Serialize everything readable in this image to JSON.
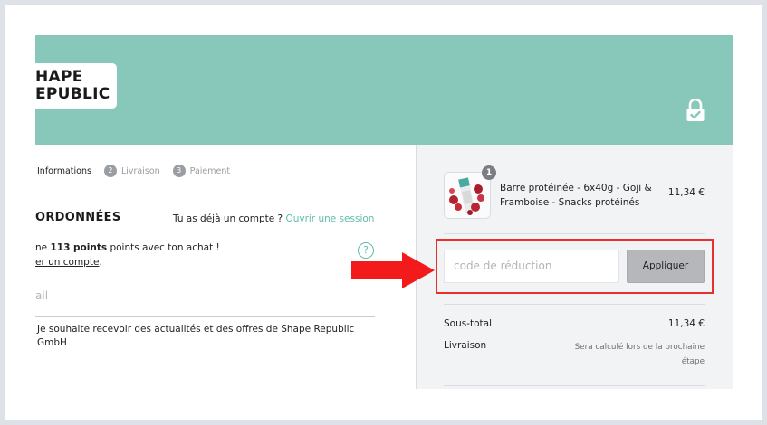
{
  "colors": {
    "header_bg": "#88c8bb",
    "accent": "#5fbcac",
    "highlight_border": "#e8302c",
    "arrow": "#f21a1a"
  },
  "brand": {
    "logo_line1": "HAPE",
    "logo_line2": "EPUBLIC"
  },
  "header": {
    "lock_icon": "lock-check-icon"
  },
  "steps": [
    {
      "label": "Informations"
    },
    {
      "number": "2",
      "label": "Livraison"
    },
    {
      "number": "3",
      "label": "Paiement"
    }
  ],
  "contact": {
    "title": "ORDONNÉES",
    "login_prompt": "Tu as déjà un compte ?",
    "login_link": "Ouvrir une session",
    "points_prefix": "ne",
    "points_value": "113 points",
    "points_suffix": "points avec ton achat !",
    "create_account": "er un compte",
    "create_account_suffix": ".",
    "help_icon_glyph": "?",
    "email_placeholder": "ail",
    "newsletter_text": "Je souhaite recevoir des actualités et des offres de Shape Republic GmbH"
  },
  "cart": {
    "items": [
      {
        "quantity": "1",
        "name": "Barre protéinée - 6x40g - Goji & Framboise - Snacks protéinés",
        "price": "11,34 €"
      }
    ],
    "discount_placeholder": "code de réduction",
    "apply_label": "Appliquer",
    "subtotal_label": "Sous-total",
    "subtotal_value": "11,34 €",
    "shipping_label": "Livraison",
    "shipping_value": "Sera calculé lors de la prochaine étape"
  }
}
